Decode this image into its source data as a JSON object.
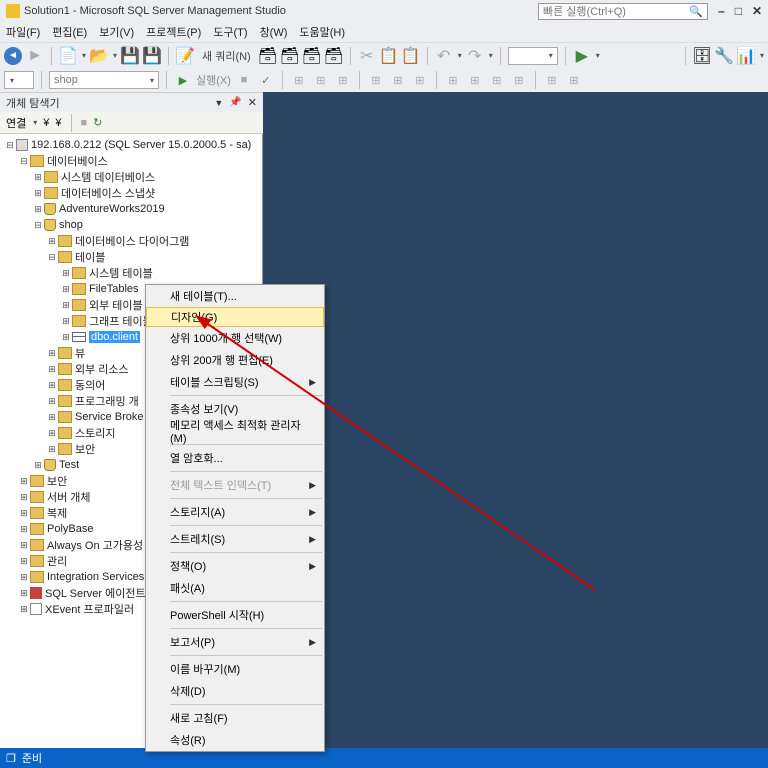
{
  "title": "Solution1 - Microsoft SQL Server Management Studio",
  "quicklaunch_placeholder": "빠른 실행(Ctrl+Q)",
  "menu": [
    "파일(F)",
    "편집(E)",
    "보기(V)",
    "프로젝트(P)",
    "도구(T)",
    "창(W)",
    "도움말(H)"
  ],
  "toolbar": {
    "new_query": "새 쿼리(N)"
  },
  "toolbar2": {
    "combo1": "",
    "combo2": "shop",
    "execute": "실행(X)"
  },
  "panel": {
    "title": "개체 탐색기",
    "connect": "연결"
  },
  "tree": {
    "server": "192.168.0.212 (SQL Server 15.0.2000.5 - sa)",
    "db_root": "데이터베이스",
    "sys_db": "시스템 데이터베이스",
    "db_snap": "데이터베이스 스냅샷",
    "aw": "AdventureWorks2019",
    "shop": "shop",
    "db_diagram": "데이터베이스 다이어그램",
    "tables": "테이블",
    "sys_tables": "시스템 테이블",
    "filetables": "FileTables",
    "ext_tables": "외부 테이블",
    "graph_tables": "그래프 테이블",
    "dbo_client": "dbo.client",
    "views": "뷰",
    "ext_res": "외부 리소스",
    "synonyms": "동의어",
    "programm": "프로그래밍 개",
    "service_broker": "Service Broke",
    "storage": "스토리지",
    "security_db": "보안",
    "test": "Test",
    "security": "보안",
    "server_obj": "서버 개체",
    "replication": "복제",
    "polybase": "PolyBase",
    "alwayson": "Always On 고가용성",
    "mgmt": "관리",
    "int_svc": "Integration Services",
    "agent": "SQL Server 에이전트",
    "xevent": "XEvent 프로파일러"
  },
  "ctx": {
    "new_table": "새 테이블(T)...",
    "design": "디자인(G)",
    "sel1000": "상위 1000개 행 선택(W)",
    "edit200": "상위 200개 행 편집(E)",
    "script": "테이블 스크립팅(S)",
    "deps": "종속성 보기(V)",
    "memopt": "메모리 액세스 최적화 관리자(M)",
    "encrypt": "열 암호화...",
    "fulltext": "전체 텍스트 인덱스(T)",
    "storage": "스토리지(A)",
    "stretch": "스트레치(S)",
    "policy": "정책(O)",
    "facet": "패싯(A)",
    "ps": "PowerShell 시작(H)",
    "report": "보고서(P)",
    "rename": "이름 바꾸기(M)",
    "delete": "삭제(D)",
    "refresh": "새로 고침(F)",
    "props": "속성(R)"
  },
  "status": "준비"
}
